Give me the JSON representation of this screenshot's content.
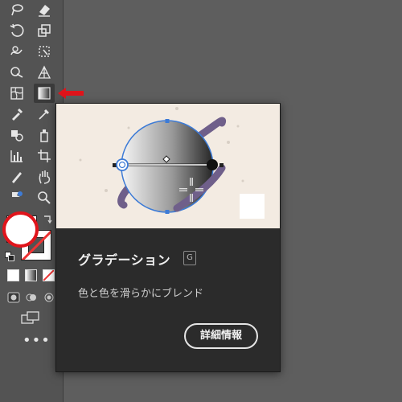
{
  "toolbar": {
    "tools": [
      "lasso-icon",
      "eraser-icon",
      "rotate-icon",
      "scale-icon",
      "warp-icon",
      "free-transform-icon",
      "shape-builder-icon",
      "perspective-grid-icon",
      "mesh-icon",
      "gradient-icon",
      "eyedropper-icon",
      "eyedropper-icon",
      "blend-icon",
      "symbol-sprayer-icon",
      "graph-icon",
      "artboard-icon",
      "slice-icon",
      "hand-icon",
      "zoom-icon"
    ],
    "selected_tool": "gradient-icon",
    "more_label": "•••"
  },
  "tooltip": {
    "title": "グラデーション",
    "shortcut": "G",
    "description": "色と色を滑らかにブレンド",
    "button_label": "詳細情報"
  },
  "colors": {
    "toolbar_bg": "#535353",
    "tooltip_bg": "#2b2b2b",
    "preview_bg": "#f3ebe2",
    "highlight_red": "#e0141b",
    "planet_ring": "#6f5f8a",
    "selection_blue": "#3d7bd6"
  }
}
